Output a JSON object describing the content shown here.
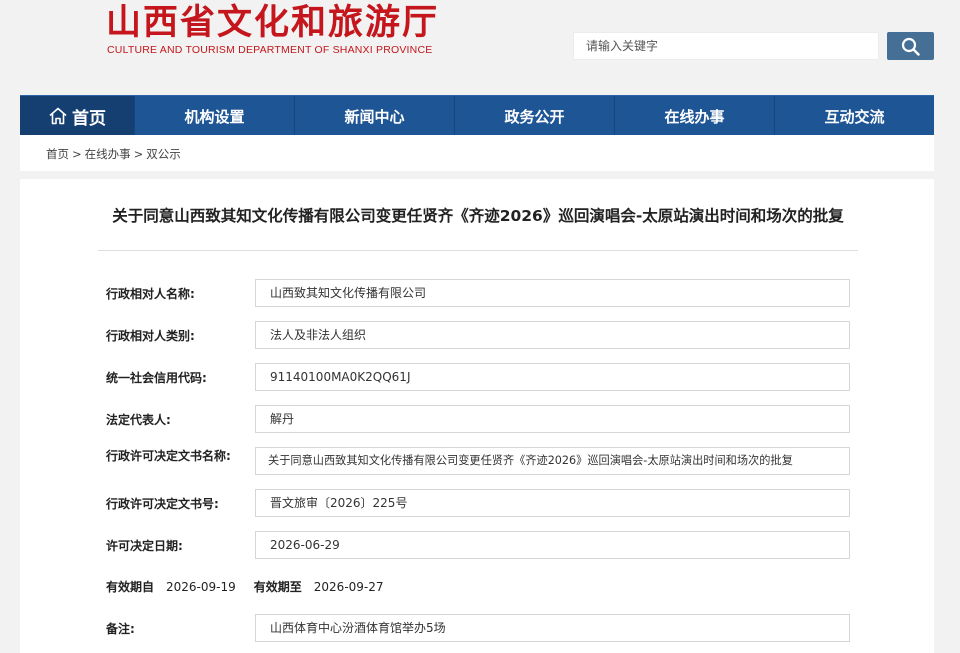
{
  "header": {
    "title": "山西省文化和旅游厅",
    "subtitle": "CULTURE AND TOURISM DEPARTMENT OF SHANXI PROVINCE",
    "search_placeholder": "请输入关键字",
    "search_icon": "search-icon",
    "brand_color": "#c4161c"
  },
  "nav": {
    "home_label": "首页",
    "home_icon": "home-icon",
    "items": [
      "机构设置",
      "新闻中心",
      "政务公开",
      "在线办事",
      "互动交流"
    ],
    "color": "#1e5594"
  },
  "breadcrumb": {
    "items": [
      "首页",
      "在线办事",
      "双公示"
    ],
    "separator": ">"
  },
  "document": {
    "title": "关于同意山西致其知文化传播有限公司变更任贤齐《齐迹2026》巡回演唱会-太原站演出时间和场次的批复",
    "fields": [
      {
        "label": "行政相对人名称:",
        "value": "山西致其知文化传播有限公司"
      },
      {
        "label": "行政相对人类别:",
        "value": "法人及非法人组织"
      },
      {
        "label": "统一社会信用代码:",
        "value": "91140100MA0K2QQ61J"
      },
      {
        "label": "法定代表人:",
        "value": "解丹"
      },
      {
        "label": "行政许可决定文书名称:",
        "value": "关于同意山西致其知文化传播有限公司变更任贤齐《齐迹2026》巡回演唱会-太原站演出时间和场次的批复"
      },
      {
        "label": "行政许可决定文书号:",
        "value": "晋文旅审〔2026〕225号"
      },
      {
        "label": "许可决定日期:",
        "value": "2026-06-29"
      }
    ],
    "validity": {
      "from_label": "有效期自",
      "from_value": "2026-09-19",
      "to_label": "有效期至",
      "to_value": "2026-09-27"
    },
    "remarks": {
      "label": "备注:",
      "value": "山西体育中心汾酒体育馆举办5场"
    }
  }
}
